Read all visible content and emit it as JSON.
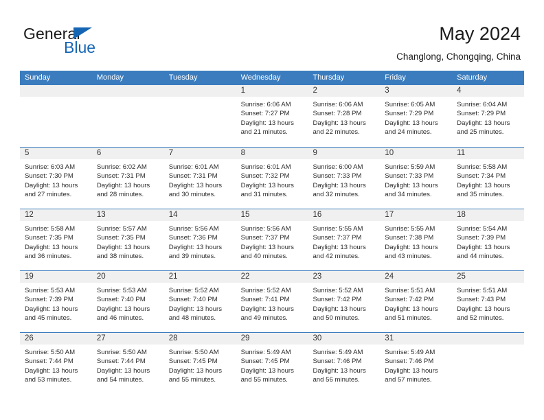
{
  "brand": {
    "name_part1": "General",
    "name_part2": "Blue",
    "flag_icon": "blue-triangle-flag-icon"
  },
  "header": {
    "title": "May 2024",
    "subtitle": "Changlong, Chongqing, China"
  },
  "colors": {
    "header_blue": "#3a7cbe",
    "brand_blue": "#1565b5",
    "day_band_gray": "#f0f0f0",
    "text": "#2b2b2b"
  },
  "weekdays": [
    "Sunday",
    "Monday",
    "Tuesday",
    "Wednesday",
    "Thursday",
    "Friday",
    "Saturday"
  ],
  "weeks": [
    [
      {
        "day": "",
        "lines": []
      },
      {
        "day": "",
        "lines": []
      },
      {
        "day": "",
        "lines": []
      },
      {
        "day": "1",
        "lines": [
          "Sunrise: 6:06 AM",
          "Sunset: 7:27 PM",
          "Daylight: 13 hours",
          "and 21 minutes."
        ]
      },
      {
        "day": "2",
        "lines": [
          "Sunrise: 6:06 AM",
          "Sunset: 7:28 PM",
          "Daylight: 13 hours",
          "and 22 minutes."
        ]
      },
      {
        "day": "3",
        "lines": [
          "Sunrise: 6:05 AM",
          "Sunset: 7:29 PM",
          "Daylight: 13 hours",
          "and 24 minutes."
        ]
      },
      {
        "day": "4",
        "lines": [
          "Sunrise: 6:04 AM",
          "Sunset: 7:29 PM",
          "Daylight: 13 hours",
          "and 25 minutes."
        ]
      }
    ],
    [
      {
        "day": "5",
        "lines": [
          "Sunrise: 6:03 AM",
          "Sunset: 7:30 PM",
          "Daylight: 13 hours",
          "and 27 minutes."
        ]
      },
      {
        "day": "6",
        "lines": [
          "Sunrise: 6:02 AM",
          "Sunset: 7:31 PM",
          "Daylight: 13 hours",
          "and 28 minutes."
        ]
      },
      {
        "day": "7",
        "lines": [
          "Sunrise: 6:01 AM",
          "Sunset: 7:31 PM",
          "Daylight: 13 hours",
          "and 30 minutes."
        ]
      },
      {
        "day": "8",
        "lines": [
          "Sunrise: 6:01 AM",
          "Sunset: 7:32 PM",
          "Daylight: 13 hours",
          "and 31 minutes."
        ]
      },
      {
        "day": "9",
        "lines": [
          "Sunrise: 6:00 AM",
          "Sunset: 7:33 PM",
          "Daylight: 13 hours",
          "and 32 minutes."
        ]
      },
      {
        "day": "10",
        "lines": [
          "Sunrise: 5:59 AM",
          "Sunset: 7:33 PM",
          "Daylight: 13 hours",
          "and 34 minutes."
        ]
      },
      {
        "day": "11",
        "lines": [
          "Sunrise: 5:58 AM",
          "Sunset: 7:34 PM",
          "Daylight: 13 hours",
          "and 35 minutes."
        ]
      }
    ],
    [
      {
        "day": "12",
        "lines": [
          "Sunrise: 5:58 AM",
          "Sunset: 7:35 PM",
          "Daylight: 13 hours",
          "and 36 minutes."
        ]
      },
      {
        "day": "13",
        "lines": [
          "Sunrise: 5:57 AM",
          "Sunset: 7:35 PM",
          "Daylight: 13 hours",
          "and 38 minutes."
        ]
      },
      {
        "day": "14",
        "lines": [
          "Sunrise: 5:56 AM",
          "Sunset: 7:36 PM",
          "Daylight: 13 hours",
          "and 39 minutes."
        ]
      },
      {
        "day": "15",
        "lines": [
          "Sunrise: 5:56 AM",
          "Sunset: 7:37 PM",
          "Daylight: 13 hours",
          "and 40 minutes."
        ]
      },
      {
        "day": "16",
        "lines": [
          "Sunrise: 5:55 AM",
          "Sunset: 7:37 PM",
          "Daylight: 13 hours",
          "and 42 minutes."
        ]
      },
      {
        "day": "17",
        "lines": [
          "Sunrise: 5:55 AM",
          "Sunset: 7:38 PM",
          "Daylight: 13 hours",
          "and 43 minutes."
        ]
      },
      {
        "day": "18",
        "lines": [
          "Sunrise: 5:54 AM",
          "Sunset: 7:39 PM",
          "Daylight: 13 hours",
          "and 44 minutes."
        ]
      }
    ],
    [
      {
        "day": "19",
        "lines": [
          "Sunrise: 5:53 AM",
          "Sunset: 7:39 PM",
          "Daylight: 13 hours",
          "and 45 minutes."
        ]
      },
      {
        "day": "20",
        "lines": [
          "Sunrise: 5:53 AM",
          "Sunset: 7:40 PM",
          "Daylight: 13 hours",
          "and 46 minutes."
        ]
      },
      {
        "day": "21",
        "lines": [
          "Sunrise: 5:52 AM",
          "Sunset: 7:40 PM",
          "Daylight: 13 hours",
          "and 48 minutes."
        ]
      },
      {
        "day": "22",
        "lines": [
          "Sunrise: 5:52 AM",
          "Sunset: 7:41 PM",
          "Daylight: 13 hours",
          "and 49 minutes."
        ]
      },
      {
        "day": "23",
        "lines": [
          "Sunrise: 5:52 AM",
          "Sunset: 7:42 PM",
          "Daylight: 13 hours",
          "and 50 minutes."
        ]
      },
      {
        "day": "24",
        "lines": [
          "Sunrise: 5:51 AM",
          "Sunset: 7:42 PM",
          "Daylight: 13 hours",
          "and 51 minutes."
        ]
      },
      {
        "day": "25",
        "lines": [
          "Sunrise: 5:51 AM",
          "Sunset: 7:43 PM",
          "Daylight: 13 hours",
          "and 52 minutes."
        ]
      }
    ],
    [
      {
        "day": "26",
        "lines": [
          "Sunrise: 5:50 AM",
          "Sunset: 7:44 PM",
          "Daylight: 13 hours",
          "and 53 minutes."
        ]
      },
      {
        "day": "27",
        "lines": [
          "Sunrise: 5:50 AM",
          "Sunset: 7:44 PM",
          "Daylight: 13 hours",
          "and 54 minutes."
        ]
      },
      {
        "day": "28",
        "lines": [
          "Sunrise: 5:50 AM",
          "Sunset: 7:45 PM",
          "Daylight: 13 hours",
          "and 55 minutes."
        ]
      },
      {
        "day": "29",
        "lines": [
          "Sunrise: 5:49 AM",
          "Sunset: 7:45 PM",
          "Daylight: 13 hours",
          "and 55 minutes."
        ]
      },
      {
        "day": "30",
        "lines": [
          "Sunrise: 5:49 AM",
          "Sunset: 7:46 PM",
          "Daylight: 13 hours",
          "and 56 minutes."
        ]
      },
      {
        "day": "31",
        "lines": [
          "Sunrise: 5:49 AM",
          "Sunset: 7:46 PM",
          "Daylight: 13 hours",
          "and 57 minutes."
        ]
      },
      {
        "day": "",
        "lines": []
      }
    ]
  ]
}
